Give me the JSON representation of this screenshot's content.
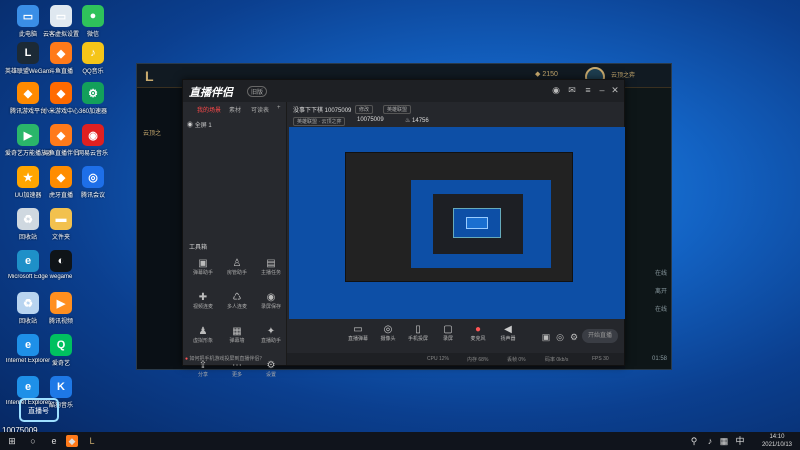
{
  "desktop_icons": [
    {
      "label": "此电脑",
      "icon": "computer-icon",
      "color": "#3a8ee6",
      "glyph": "▭"
    },
    {
      "label": "云客虚拟设置",
      "icon": "monitor-icon",
      "color": "#dfe8f0",
      "glyph": "▭"
    },
    {
      "label": "微信",
      "icon": "wechat-icon",
      "color": "#2fc25b",
      "glyph": "●"
    },
    {
      "label": "英雄联盟WeGame版",
      "icon": "lol-icon",
      "color": "#1c2a36",
      "glyph": "L"
    },
    {
      "label": "斗鱼直播",
      "icon": "douyu-icon",
      "color": "#ff7a1a",
      "glyph": "◆"
    },
    {
      "label": "QQ音乐",
      "icon": "qqmusic-icon",
      "color": "#f5c518",
      "glyph": "♪"
    },
    {
      "label": "腾讯游戏平台",
      "icon": "tgp-icon",
      "color": "#ff8a00",
      "glyph": "◆"
    },
    {
      "label": "小米游戏中心",
      "icon": "xiaomi-icon",
      "color": "#ff6a00",
      "glyph": "◆"
    },
    {
      "label": "360加速器",
      "icon": "accelerator-icon",
      "color": "#13a05b",
      "glyph": "⚙"
    },
    {
      "label": "爱奇艺万能播放器",
      "icon": "player-icon",
      "color": "#2ab66a",
      "glyph": "▶"
    },
    {
      "label": "斗鱼直播伴侣",
      "icon": "companion-icon",
      "color": "#ff7a1a",
      "glyph": "◆"
    },
    {
      "label": "网易云音乐",
      "icon": "netease-icon",
      "color": "#e02020",
      "glyph": "◉"
    },
    {
      "label": "UU加速器",
      "icon": "uu-icon",
      "color": "#ffa500",
      "glyph": "★"
    },
    {
      "label": "虎牙直播",
      "icon": "huya-icon",
      "color": "#ff8c00",
      "glyph": "◆"
    },
    {
      "label": "腾讯会议",
      "icon": "meeting-icon",
      "color": "#1e6fe8",
      "glyph": "◎"
    },
    {
      "label": "回收站",
      "icon": "recycle-icon",
      "color": "#cfd8e0",
      "glyph": "♻"
    },
    {
      "label": "文件夹",
      "icon": "folder-icon",
      "color": "#f2c14e",
      "glyph": "▬"
    },
    {
      "label": "Microsoft Edge",
      "icon": "edge-icon",
      "color": "#1e90c8",
      "glyph": "e"
    },
    {
      "label": "wegame",
      "icon": "wegame-icon",
      "color": "#0f1418",
      "glyph": "◐"
    },
    {
      "label": "回收站",
      "icon": "bin-icon",
      "color": "#b8d4f0",
      "glyph": "♻"
    },
    {
      "label": "腾讯视频",
      "icon": "tencent-video-icon",
      "color": "#ff8f1f",
      "glyph": "▶"
    },
    {
      "label": "Internet Explorer",
      "icon": "ie-icon",
      "color": "#1e90e8",
      "glyph": "e"
    },
    {
      "label": "爱奇艺",
      "icon": "iqiyi-icon",
      "color": "#00c060",
      "glyph": "Q"
    },
    {
      "label": "Internet Explorer",
      "icon": "ie-icon-2",
      "color": "#1e90e8",
      "glyph": "e"
    },
    {
      "label": "酷狗音乐",
      "icon": "kugou-icon",
      "color": "#1e78e6",
      "glyph": "K"
    },
    {
      "label": "QQ",
      "icon": "qq-icon",
      "color": "#111111",
      "glyph": "●"
    }
  ],
  "game": {
    "title": "云顶之",
    "coins": "2150",
    "right_items": [
      "进行中",
      "云顶之弈",
      "在线",
      "离开",
      "在线",
      "召唤师",
      "好友"
    ],
    "time": "01:58"
  },
  "stream": {
    "brand": "直播伴侣",
    "badge": "旧版",
    "tabs": [
      "我的场景",
      "素材",
      "可读表"
    ],
    "scene_name": "全屏 1",
    "tools_heading": "工具箱",
    "tools": [
      {
        "label": "弹幕助手",
        "icon": "danmaku-icon"
      },
      {
        "label": "房管助手",
        "icon": "admin-icon"
      },
      {
        "label": "主播任务",
        "icon": "task-icon"
      },
      {
        "label": "视频连麦",
        "icon": "video-link-icon"
      },
      {
        "label": "多人连麦",
        "icon": "multi-link-icon"
      },
      {
        "label": "录屏保存",
        "icon": "record-icon"
      },
      {
        "label": "虚拟形象",
        "icon": "avatar-tool-icon"
      },
      {
        "label": "弹幕墙",
        "icon": "wall-icon"
      },
      {
        "label": "直播助手",
        "icon": "helper-icon"
      },
      {
        "label": "分享",
        "icon": "share-icon"
      },
      {
        "label": "更多",
        "icon": "more-icon"
      },
      {
        "label": "设置",
        "icon": "settings-icon"
      }
    ],
    "tip": "如何把手机游戏投屏到直播伴侣？",
    "room_title": "没事下下棋 10075009",
    "edit_label": "修改",
    "category_label": "英雄联盟",
    "game_tag": "英雄联盟 · 云顶之弈",
    "room_id": "10075009",
    "fans": "14756",
    "controls": [
      {
        "label": "直播弹幕",
        "icon": "barrage-icon"
      },
      {
        "label": "摄像头",
        "icon": "camera-icon"
      },
      {
        "label": "手机投屏",
        "icon": "phone-cast-icon"
      },
      {
        "label": "录屏",
        "icon": "screen-icon"
      },
      {
        "label": "麦克风",
        "icon": "mic-icon"
      },
      {
        "label": "扬声器",
        "icon": "speaker-icon"
      }
    ],
    "start_label": "开始直播",
    "status": [
      "CPU 12%",
      "内存 68%",
      "丢帧 0%",
      "码率 0kb/s",
      "FPS 30"
    ]
  },
  "overlay": {
    "live_logo": "直播号",
    "room_number": "10075009"
  },
  "taskbar": {
    "time": "14:10",
    "date": "2021/10/13"
  }
}
